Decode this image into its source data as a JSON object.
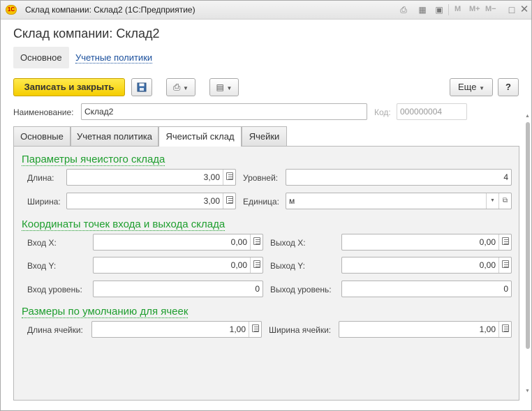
{
  "window": {
    "app_logo": "1С",
    "title": "Склад компании: Склад2  (1С:Предприятие)",
    "toolbar_m": "M",
    "toolbar_mplus": "M+",
    "toolbar_mminus": "M−"
  },
  "form": {
    "title": "Склад компании: Склад2",
    "nav": {
      "main": "Основное",
      "policies": "Учетные политики"
    }
  },
  "command_bar": {
    "save_close": "Записать и закрыть",
    "more": "Еще",
    "help": "?"
  },
  "header_fields": {
    "name_label": "Наименование:",
    "name_value": "Склад2",
    "code_label": "Код:",
    "code_value": "000000004"
  },
  "tabs": [
    "Основные",
    "Учетная политика",
    "Ячеистый склад",
    "Ячейки"
  ],
  "params": {
    "title": "Параметры ячеистого склада",
    "length_label": "Длина:",
    "length_value": "3,00",
    "width_label": "Ширина:",
    "width_value": "3,00",
    "levels_label": "Уровней:",
    "levels_value": "4",
    "unit_label": "Единица:",
    "unit_value": "м"
  },
  "coords": {
    "title": "Координаты точек входа и выхода склада",
    "in_x_label": "Вход X:",
    "in_x_value": "0,00",
    "out_x_label": "Выход X:",
    "out_x_value": "0,00",
    "in_y_label": "Вход Y:",
    "in_y_value": "0,00",
    "out_y_label": "Выход Y:",
    "out_y_value": "0,00",
    "in_level_label": "Вход уровень:",
    "in_level_value": "0",
    "out_level_label": "Выход уровень:",
    "out_level_value": "0"
  },
  "defaults": {
    "title": "Размеры по умолчанию для ячеек",
    "cell_length_label": "Длина ячейки:",
    "cell_length_value": "1,00",
    "cell_width_label": "Ширина ячейки:",
    "cell_width_value": "1,00"
  },
  "colors": {
    "accent_yellow": "#f5cd00",
    "section_green": "#1e9e2e",
    "link_blue": "#1a4f9c"
  },
  "icons": [
    "save-icon",
    "print-icon",
    "report-icon",
    "calculator-icon",
    "open-icon",
    "chevron-down-icon"
  ]
}
